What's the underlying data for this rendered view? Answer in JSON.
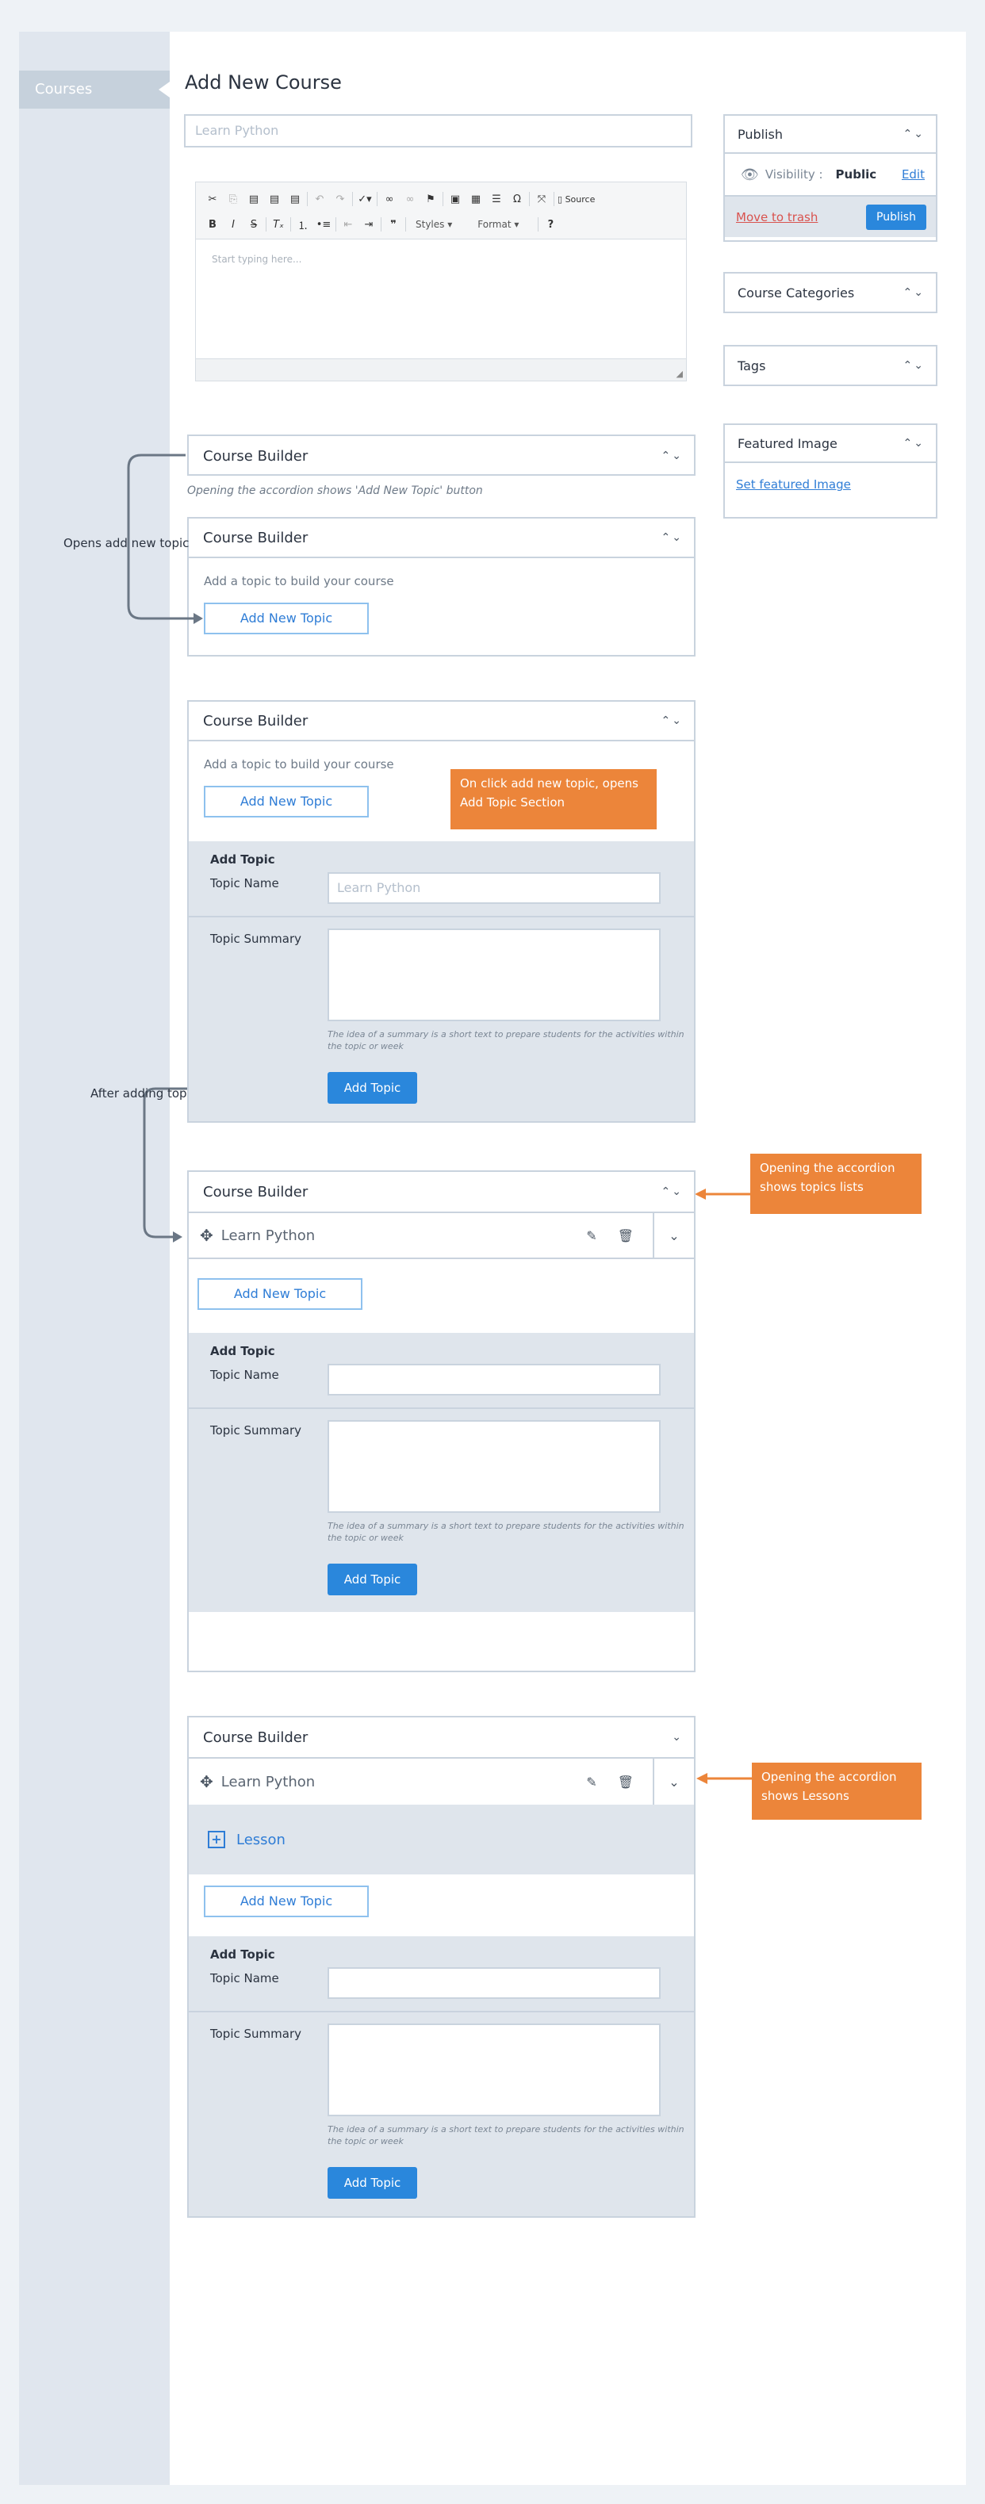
{
  "sidebar": {
    "courses_label": "Courses"
  },
  "header": {
    "page_title": "Add New Course"
  },
  "course_title": {
    "placeholder": "Learn Python"
  },
  "editor": {
    "source_label": "Source",
    "styles_label": "Styles",
    "format_label": "Format",
    "help_label": "?",
    "body_placeholder": "Start typing here..."
  },
  "publish_box": {
    "title": "Publish",
    "visibility_label": "Visibility :",
    "visibility_value": "Public",
    "edit_label": "Edit",
    "trash_label": "Move to trash",
    "publish_button": "Publish"
  },
  "course_categories": {
    "title": "Course Categories"
  },
  "tags": {
    "title": "Tags"
  },
  "featured_image": {
    "title": "Featured Image",
    "link_label": "Set featured Image"
  },
  "builder": {
    "title": "Course Builder",
    "hint": "Add a topic to build your course",
    "add_new_topic": "Add New Topic",
    "add_topic_heading": "Add Topic",
    "topic_name_label": "Topic Name",
    "topic_name_placeholder": "Learn Python",
    "topic_summary_label": "Topic Summary",
    "summary_help_1": "The idea of a summary is a short text to prepare students for the activities within",
    "summary_help_2": "the topic or week",
    "add_topic_button": "Add Topic",
    "topic_title": "Learn Python",
    "lesson_label": "Lesson"
  },
  "annotations": {
    "accordion_note": "Opening the accordion shows 'Add New Topic' button",
    "opens_add_new_topic": "Opens add new topic",
    "after_adding_topic": "After adding topic",
    "callout_add_topic_1": "On click add new topic, opens",
    "callout_add_topic_2": "Add Topic Section",
    "callout_topics_1": "Opening the accordion",
    "callout_topics_2": "shows topics lists",
    "callout_lessons_1": "Opening the accordion",
    "callout_lessons_2": "shows Lessons"
  },
  "colors": {
    "accent": "#2a87dc",
    "callout": "#ec853a",
    "sidebar": "#e0e6ee",
    "danger": "#d9534f"
  }
}
